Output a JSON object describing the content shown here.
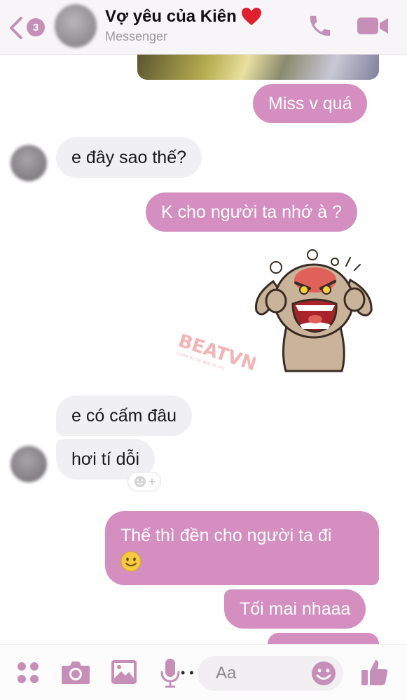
{
  "header": {
    "back_count": "3",
    "title": "Vợ yêu của Kiên",
    "subtitle": "Messenger",
    "accent": "#c68fb7"
  },
  "messages": [
    {
      "direction": "out",
      "text": "Miss v quá"
    },
    {
      "direction": "in",
      "text": "e đây sao thế?"
    },
    {
      "direction": "out",
      "text": "K cho người ta nhớ à ?"
    },
    {
      "direction": "in",
      "text": "e có cấm đâu"
    },
    {
      "direction": "in",
      "text": "hơi tí dỗi"
    },
    {
      "direction": "out",
      "text": "Thế thì đền cho người ta đi"
    },
    {
      "direction": "out",
      "text": "Tối mai nhaaa"
    }
  ],
  "watermark": {
    "brand": "BEATVN",
    "tagline": "LISTEN TO THE BEAT OF LIFE"
  },
  "reaction": {
    "plus": "+"
  },
  "composer": {
    "placeholder": "Aa"
  },
  "colors": {
    "outgoing_bubble": "#d48ec0",
    "incoming_bubble": "#f0eff1",
    "icons": "#c68fb7"
  }
}
